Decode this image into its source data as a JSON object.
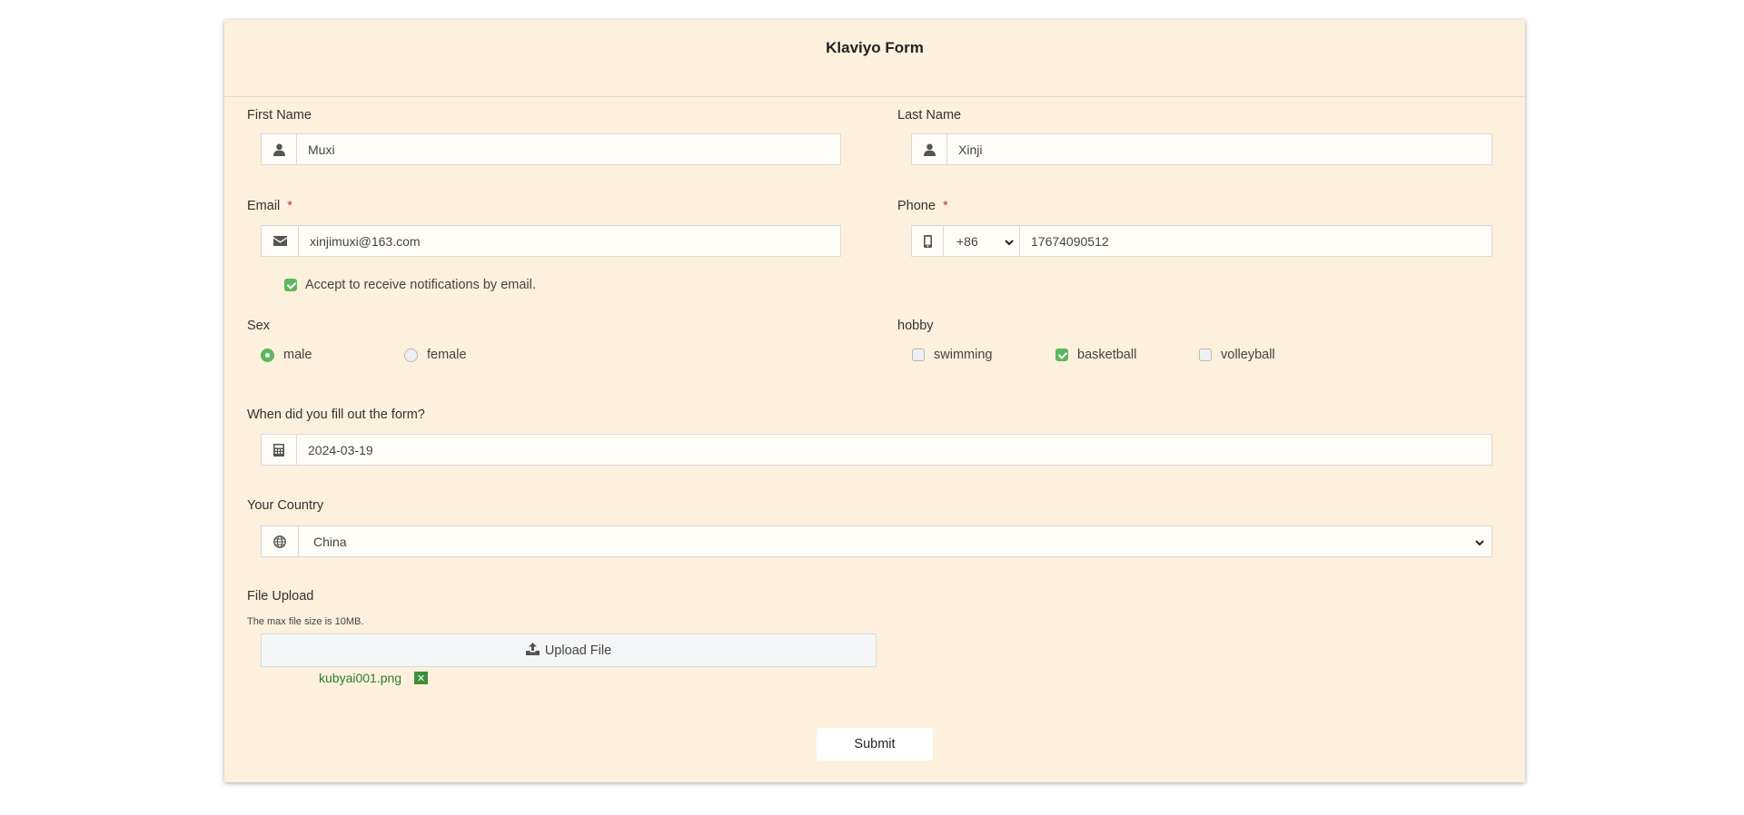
{
  "form": {
    "title": "Klaviyo Form",
    "first_name": {
      "label": "First Name",
      "value": "Muxi"
    },
    "last_name": {
      "label": "Last Name",
      "value": "Xinji"
    },
    "email": {
      "label": "Email",
      "required_mark": "*",
      "value": "xinjimuxi@163.com"
    },
    "phone": {
      "label": "Phone",
      "required_mark": "*",
      "country_code": "+86",
      "value": "17674090512"
    },
    "notifications": {
      "label": "Accept to receive notifications by email.",
      "checked": true
    },
    "sex": {
      "label": "Sex",
      "options": [
        {
          "label": "male",
          "selected": true
        },
        {
          "label": "female",
          "selected": false
        }
      ]
    },
    "hobby": {
      "label": "hobby",
      "options": [
        {
          "label": "swimming",
          "checked": false
        },
        {
          "label": "basketball",
          "checked": true
        },
        {
          "label": "volleyball",
          "checked": false
        }
      ]
    },
    "date": {
      "label": "When did you fill out the form?",
      "value": "2024-03-19"
    },
    "country": {
      "label": "Your Country",
      "value": "China"
    },
    "file_upload": {
      "label": "File Upload",
      "hint": "The max file size is 10MB.",
      "button_label": "Upload File",
      "file_name": "kubyai001.png",
      "remove_glyph": "✕"
    },
    "submit_label": "Submit"
  },
  "colors": {
    "card_background": "#fdf0dc",
    "accent_green": "#5cb85c",
    "file_green": "#2e7d32",
    "required_red": "#c0392b"
  },
  "icons": {
    "first_name": "user-icon",
    "last_name": "user-icon",
    "email": "envelope-icon",
    "phone": "mobile-phone-icon",
    "date": "calculator-icon",
    "country": "globe-icon",
    "upload": "upload-icon"
  }
}
